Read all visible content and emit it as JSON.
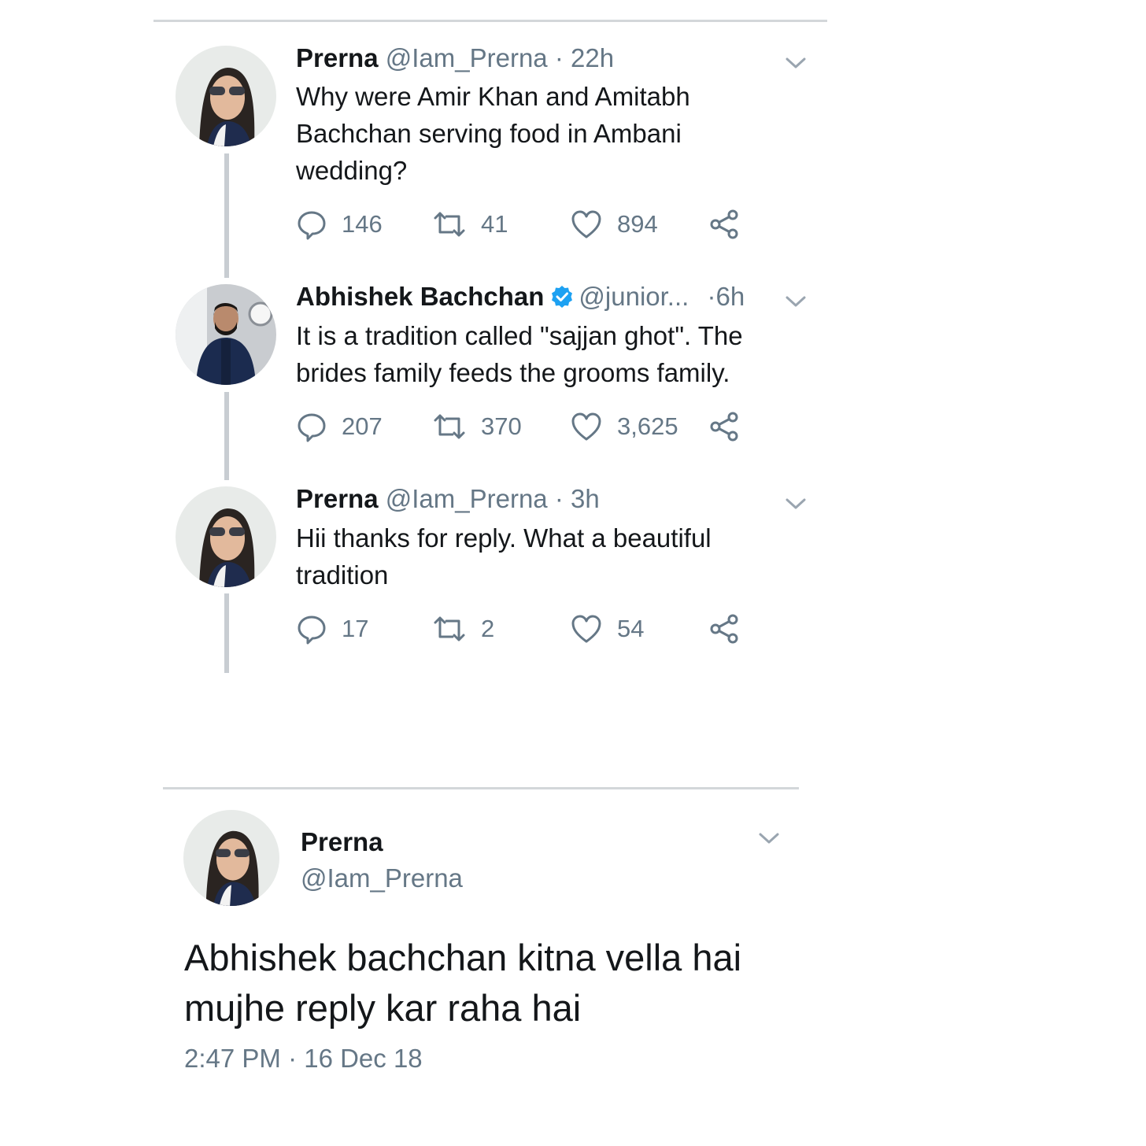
{
  "thread": [
    {
      "name": "Prerna",
      "handle": "@Iam_Prerna",
      "time": "22h",
      "text": "Why were Amir Khan and Amitabh Bachchan serving food in Ambani wedding?",
      "replies": "146",
      "retweets": "41",
      "likes": "894",
      "verified": false
    },
    {
      "name": "Abhishek Bachchan",
      "handle": "@junior...",
      "time": "6h",
      "text": "It is a tradition called \"sajjan ghot\". The brides family feeds the grooms family.",
      "replies": "207",
      "retweets": "370",
      "likes": "3,625",
      "verified": true
    },
    {
      "name": "Prerna",
      "handle": "@Iam_Prerna",
      "time": "3h",
      "text": "Hii thanks for reply. What a beautiful tradition",
      "replies": "17",
      "retweets": "2",
      "likes": "54",
      "verified": false
    }
  ],
  "detail": {
    "name": "Prerna",
    "handle": "@Iam_Prerna",
    "text": "Abhishek bachchan kitna vella hai mujhe reply kar raha hai",
    "timestamp": "2:47 PM · 16 Dec 18"
  },
  "separator": "·",
  "icons": {
    "reply": "reply-icon",
    "retweet": "retweet-icon",
    "like": "heart-icon",
    "share": "share-icon",
    "menu": "chevron-down-icon",
    "verified": "verified-badge-icon"
  },
  "colors": {
    "text": "#14171a",
    "muted": "#657786",
    "verified": "#1da1f2",
    "thread_line": "#c8cdd2"
  }
}
